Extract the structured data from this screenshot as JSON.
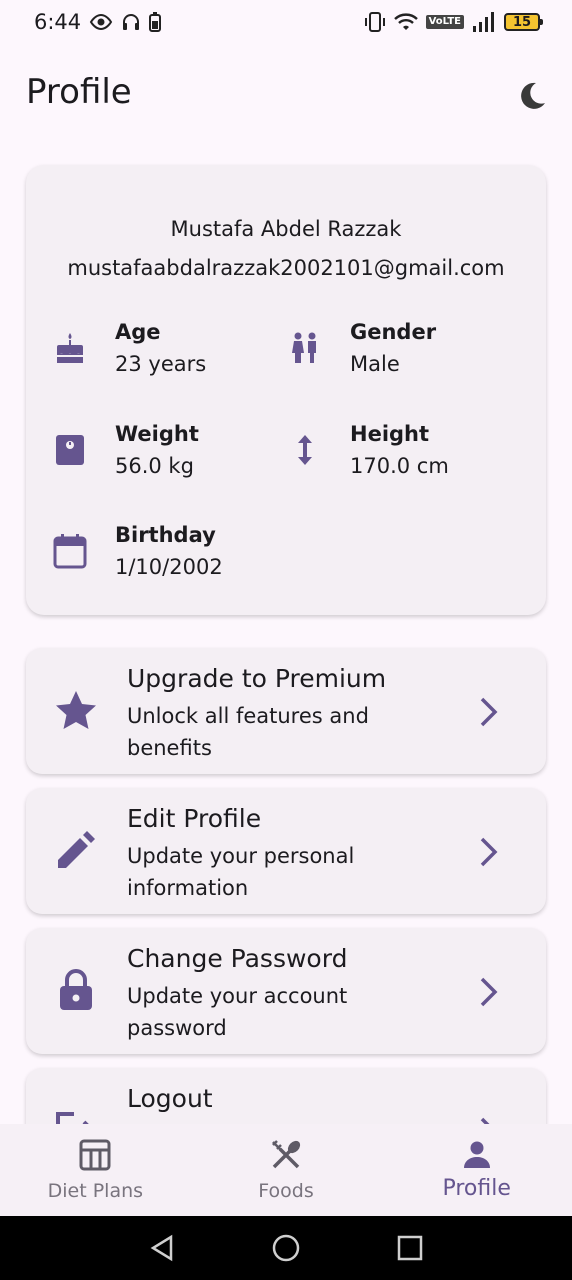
{
  "status_bar": {
    "time": "6:44",
    "network_badge": "VoLTE",
    "battery": "15"
  },
  "header": {
    "title": "Profile",
    "theme_icon": "moon-icon"
  },
  "profile": {
    "name": "Mustafa Abdel Razzak",
    "email": "mustafaabdalrazzak2002101@gmail.com",
    "age_label": "Age",
    "age_value": "23 years",
    "gender_label": "Gender",
    "gender_value": "Male",
    "weight_label": "Weight",
    "weight_value": "56.0 kg",
    "height_label": "Height",
    "height_value": "170.0 cm",
    "birthday_label": "Birthday",
    "birthday_value": "1/10/2002"
  },
  "menu": [
    {
      "title": "Upgrade to Premium",
      "subtitle": "Unlock all features and benefits",
      "icon": "star-icon"
    },
    {
      "title": "Edit Profile",
      "subtitle": "Update your personal information",
      "icon": "pencil-icon"
    },
    {
      "title": "Change Password",
      "subtitle": "Update your account password",
      "icon": "lock-icon"
    },
    {
      "title": "Logout",
      "subtitle": "",
      "icon": "logout-icon"
    }
  ],
  "bottom_nav": [
    {
      "label": "Diet Plans",
      "icon": "table-icon",
      "active": false
    },
    {
      "label": "Foods",
      "icon": "utensils-icon",
      "active": false
    },
    {
      "label": "Profile",
      "icon": "person-icon",
      "active": true
    }
  ],
  "colors": {
    "accent": "#65558f",
    "background": "#fdf7fd",
    "card": "#f4eff4",
    "inactive": "#79747e"
  }
}
